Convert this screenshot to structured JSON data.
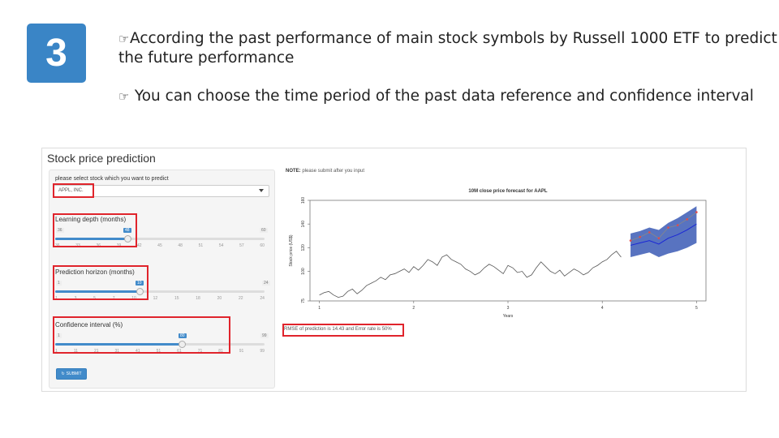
{
  "slide": {
    "step_number": "3",
    "bullets": [
      {
        "icon": "hand-point-icon",
        "text": "According the past performance of main stock symbols by Russell 1000 ETF to predict the future performance"
      },
      {
        "icon": "hand-point-icon",
        "text": " You can choose the time period of the past data reference and confidence interval"
      }
    ]
  },
  "app": {
    "title": "Stock price prediction",
    "stock_select": {
      "label": "please select stock which you want to predict",
      "value": "APPL, INC."
    },
    "learning_depth": {
      "label": "Learning depth (months)",
      "min": "36",
      "max": "60",
      "value": "48",
      "ticks": [
        "36",
        "33",
        "36",
        "39",
        "42",
        "45",
        "48",
        "51",
        "54",
        "57",
        "60"
      ]
    },
    "prediction_horizon": {
      "label": "Prediction horizon (months)",
      "min": "1",
      "max": "24",
      "value": "10",
      "ticks": [
        "1",
        "3",
        "5",
        "7",
        "10",
        "12",
        "15",
        "18",
        "20",
        "22",
        "24"
      ]
    },
    "confidence_interval": {
      "label": "Confidence interval (%)",
      "min": "1",
      "max": "99",
      "value": "80",
      "ticks": [
        "1",
        "11",
        "21",
        "31",
        "41",
        "51",
        "61",
        "71",
        "81",
        "91",
        "99"
      ]
    },
    "submit_label": "SUBMIT",
    "note_label": "NOTE:",
    "note_text": " please submit after you input",
    "rmse_text": "RMSE of prediction is 14.43 and Error rate is 50%"
  },
  "colors": {
    "accent": "#3a85c6",
    "highlight": "#e0242c",
    "band": "#3b5bb5",
    "forecast": "#1a27d6"
  },
  "chart_data": {
    "type": "line",
    "title": "10M close price forecast for AAPL",
    "xlabel": "Years",
    "ylabel": "Stock price (US$)",
    "xlim": [
      0.9,
      5.1
    ],
    "ylim": [
      75,
      160
    ],
    "x_ticks": [
      "1",
      "2",
      "3",
      "4",
      "5"
    ],
    "y_ticks": [
      "75",
      "100",
      "120",
      "140",
      "160"
    ],
    "series": [
      {
        "x": [
          1.0,
          1.05,
          1.1,
          1.15,
          1.2,
          1.25,
          1.3,
          1.35,
          1.4,
          1.45,
          1.5,
          1.55,
          1.6,
          1.65,
          1.7,
          1.75,
          1.8,
          1.85,
          1.9,
          1.95,
          2.0,
          2.05,
          2.1,
          2.15,
          2.2,
          2.25,
          2.3,
          2.35,
          2.4,
          2.45,
          2.5,
          2.55,
          2.6,
          2.65,
          2.7,
          2.75,
          2.8,
          2.85,
          2.9,
          2.95,
          3.0,
          3.05,
          3.1,
          3.15,
          3.2,
          3.25,
          3.3,
          3.35,
          3.4,
          3.45,
          3.5,
          3.55,
          3.6,
          3.65,
          3.7,
          3.75,
          3.8,
          3.85,
          3.9,
          3.95,
          4.0,
          4.05,
          4.1,
          4.15,
          4.2
        ],
        "y": [
          80,
          82,
          83,
          80,
          78,
          79,
          83,
          85,
          81,
          84,
          88,
          90,
          92,
          95,
          93,
          97,
          98,
          100,
          102,
          99,
          104,
          101,
          105,
          110,
          108,
          105,
          112,
          114,
          110,
          108,
          106,
          102,
          100,
          97,
          99,
          103,
          106,
          104,
          101,
          98,
          105,
          103,
          99,
          100,
          95,
          97,
          103,
          108,
          104,
          100,
          98,
          101,
          96,
          99,
          102,
          100,
          97,
          99,
          103,
          105,
          108,
          110,
          114,
          117,
          112
        ]
      }
    ],
    "forecast": {
      "x": [
        4.3,
        4.4,
        4.5,
        4.6,
        4.7,
        4.8,
        4.9,
        5.0
      ],
      "y": [
        122,
        124,
        126,
        123,
        128,
        131,
        135,
        140
      ]
    },
    "actual": {
      "x": [
        4.3,
        4.4,
        4.5,
        4.6,
        4.7,
        4.8,
        4.9,
        5.0
      ],
      "y": [
        126,
        129,
        133,
        128,
        137,
        139,
        144,
        150
      ]
    },
    "band": {
      "upper": [
        132,
        134,
        137,
        135,
        141,
        145,
        150,
        155
      ],
      "lower": [
        112,
        114,
        116,
        112,
        115,
        117,
        120,
        124
      ]
    }
  }
}
